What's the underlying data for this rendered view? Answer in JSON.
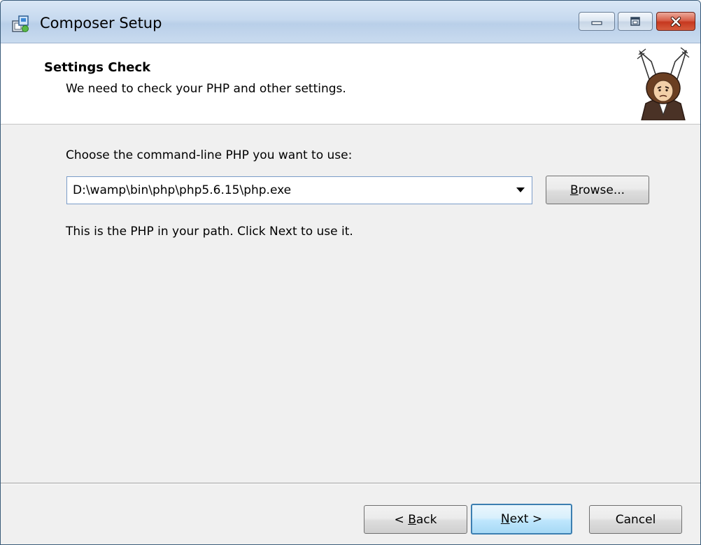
{
  "window": {
    "title": "Composer Setup",
    "icons": {
      "app": "installer-package-icon",
      "minimize": "minimize-icon",
      "maximize": "maximize-icon",
      "close": "close-icon",
      "logo": "composer-conductor-logo"
    },
    "colors": {
      "close_button": "#c6381f",
      "default_button_border": "#3c7fb1",
      "input_border": "#7a9cc8"
    }
  },
  "header": {
    "title": "Settings Check",
    "subtitle": "We need to check your PHP and other settings."
  },
  "content": {
    "choose_label": "Choose the command-line PHP you want to use:",
    "php_path": "D:\\wamp\\bin\\php\\php5.6.15\\php.exe",
    "browse": {
      "mnemonic": "B",
      "rest": "rowse..."
    },
    "note": "This is the PHP in your path. Click Next to use it."
  },
  "footer": {
    "back": {
      "prefix": "< ",
      "mnemonic": "B",
      "rest": "ack"
    },
    "next": {
      "mnemonic": "N",
      "rest": "ext >"
    },
    "cancel": "Cancel"
  }
}
